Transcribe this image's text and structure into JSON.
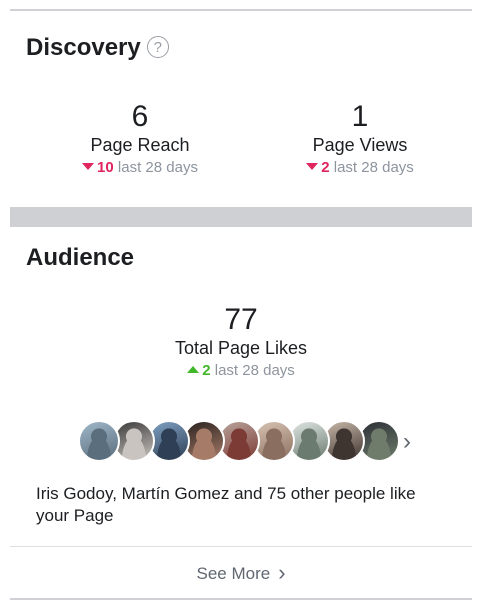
{
  "discovery": {
    "title": "Discovery",
    "help_icon": "question-circle-icon",
    "page_reach": {
      "value": "6",
      "label": "Page Reach",
      "delta_direction": "down",
      "delta_value": "10",
      "delta_period": "last 28 days"
    },
    "page_views": {
      "value": "1",
      "label": "Page Views",
      "delta_direction": "down",
      "delta_value": "2",
      "delta_period": "last 28 days"
    }
  },
  "audience": {
    "title": "Audience",
    "total_page_likes": {
      "value": "77",
      "label": "Total Page Likes",
      "delta_direction": "up",
      "delta_value": "2",
      "delta_period": "last 28 days"
    },
    "avatar_count": 9,
    "likes_text": "Iris Godoy, Martín Gomez and 75 other people like your Page",
    "see_more_label": "See More"
  },
  "colors": {
    "down": "#e0245e",
    "up": "#42b72a",
    "muted": "#8d949e",
    "band": "#ced0d4"
  }
}
